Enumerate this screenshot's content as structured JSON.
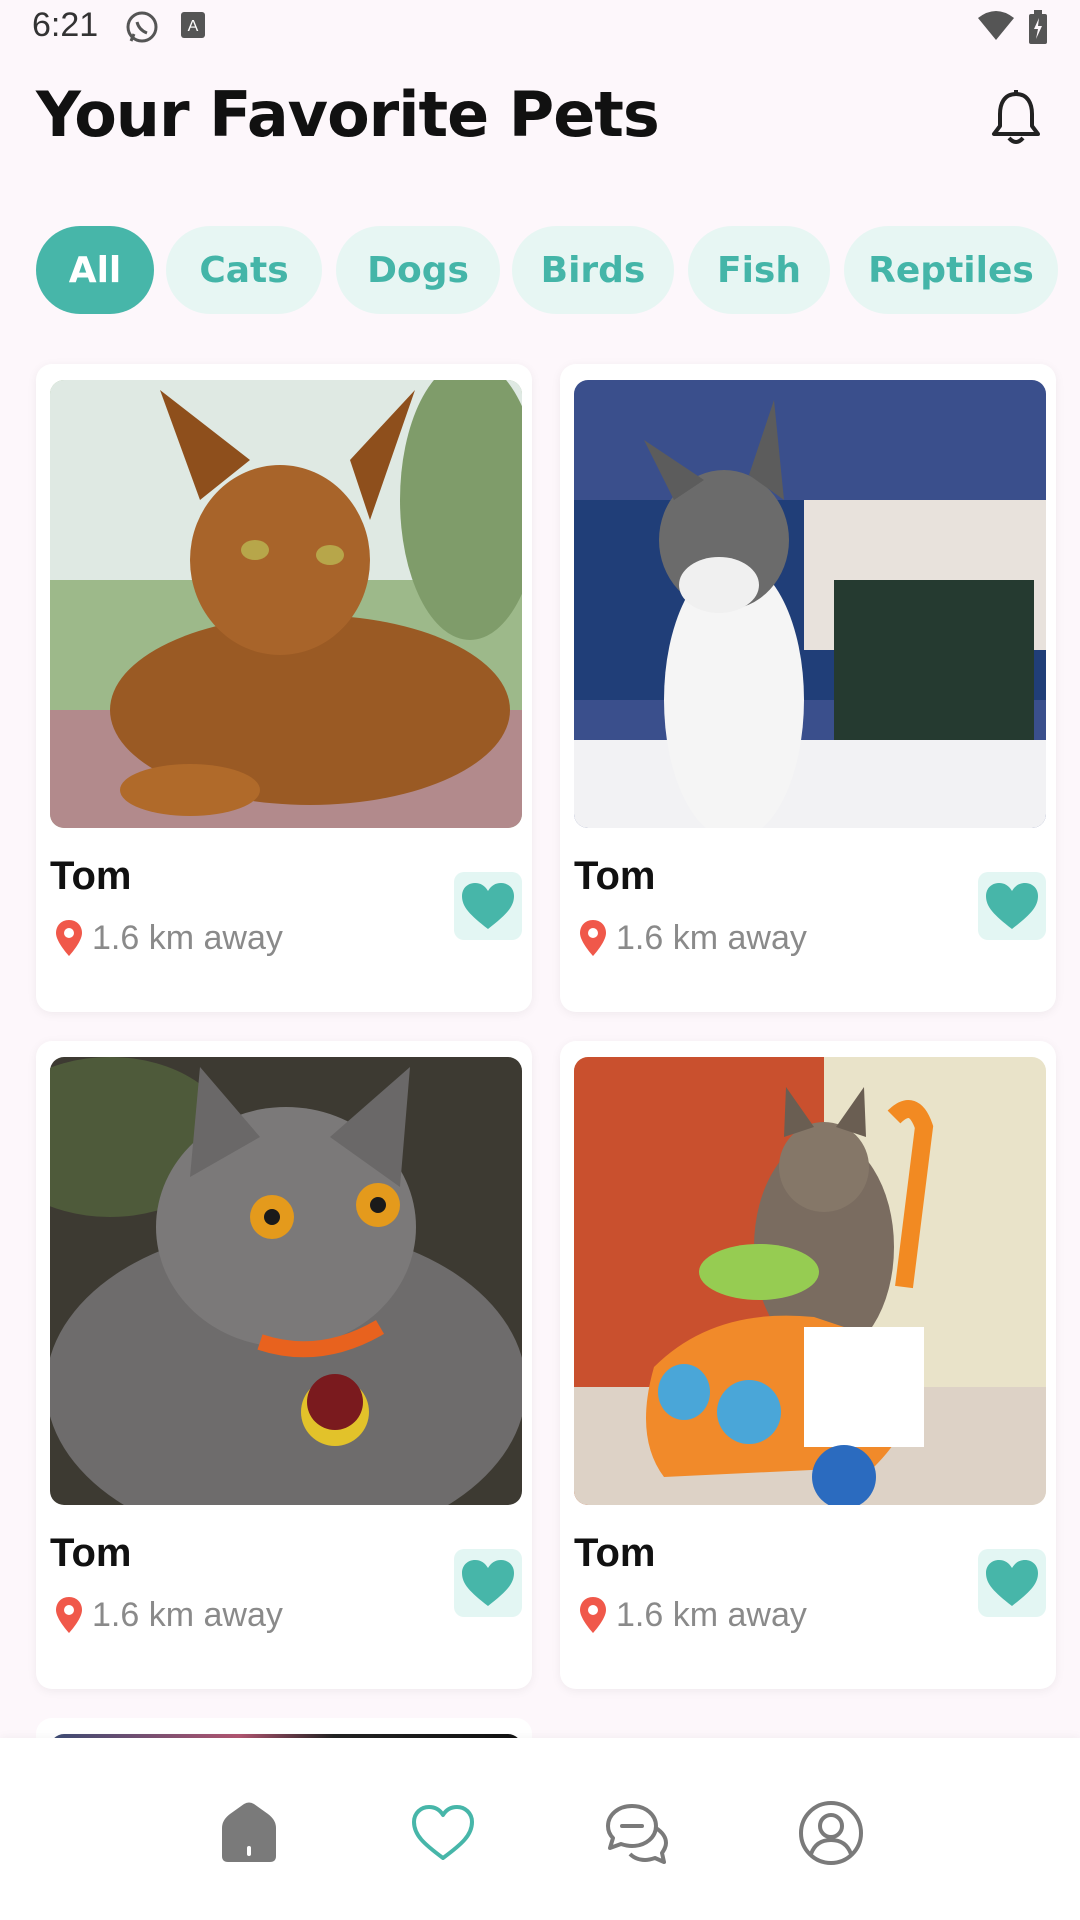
{
  "status_bar": {
    "time": "6:21",
    "icons": [
      "whatsapp-icon",
      "keyboard-a-icon",
      "wifi-icon",
      "battery-charging-icon"
    ]
  },
  "header": {
    "title": "Your Favorite Pets",
    "notification_icon": "bell-icon"
  },
  "categories": [
    {
      "label": "All",
      "selected": true
    },
    {
      "label": "Cats",
      "selected": false
    },
    {
      "label": "Dogs",
      "selected": false
    },
    {
      "label": "Birds",
      "selected": false
    },
    {
      "label": "Fish",
      "selected": false
    },
    {
      "label": "Reptiles",
      "selected": false
    }
  ],
  "pets": [
    {
      "name": "Tom",
      "distance": "1.6 km away",
      "favorited": true,
      "photo": "abyssinian cat lying outdoors"
    },
    {
      "name": "Tom",
      "distance": "1.6 km away",
      "favorited": true,
      "photo": "tabby and white cat by the sea"
    },
    {
      "name": "Tom",
      "distance": "1.6 km away",
      "favorited": true,
      "photo": "grey british shorthair with collar tag"
    },
    {
      "name": "Tom",
      "distance": "1.6 km away",
      "favorited": true,
      "photo": "long-haired cat on toy ride-on car"
    }
  ],
  "bottom_nav": {
    "items": [
      "home-icon",
      "heart-icon",
      "chat-icon",
      "profile-icon"
    ],
    "active": "heart-icon"
  },
  "colors": {
    "accent": "#47b6a9",
    "chip_bg": "#e7f6f3",
    "pin": "#f0584a",
    "background": "#fdf7fb"
  }
}
